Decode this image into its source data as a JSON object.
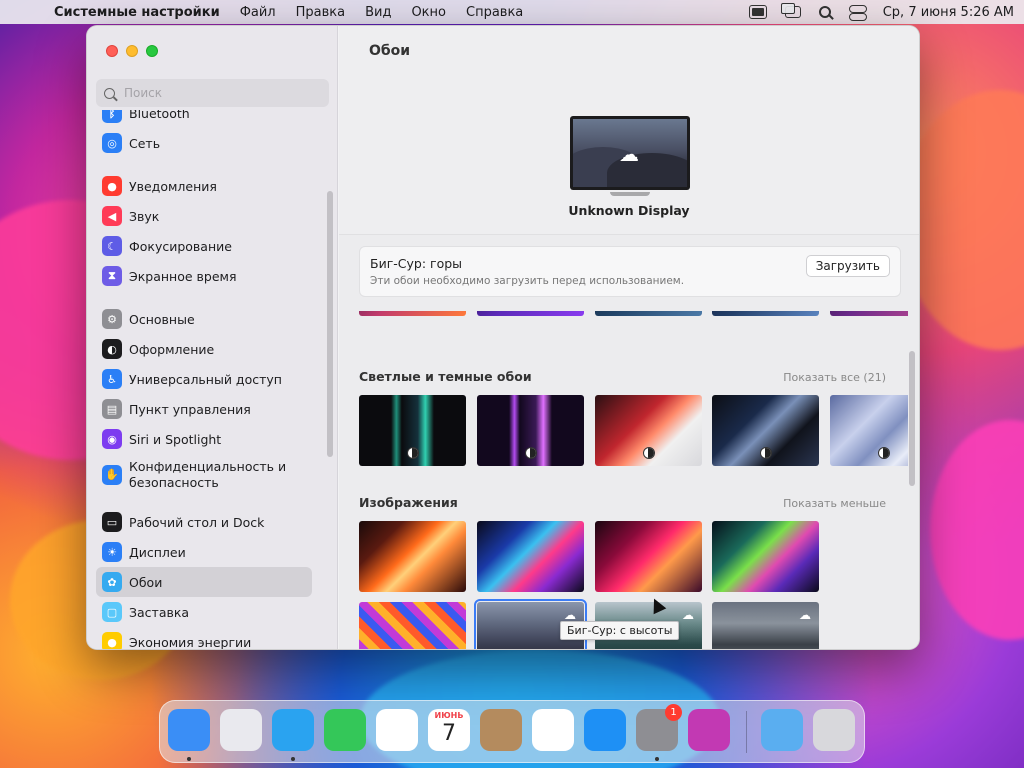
{
  "menubar": {
    "app_name": "Системные настройки",
    "items": [
      "Файл",
      "Правка",
      "Вид",
      "Окно",
      "Справка"
    ],
    "datetime": "Ср, 7 июня  5:26 AM"
  },
  "sidebar": {
    "search_placeholder": "Поиск",
    "items": [
      {
        "label": "Bluetooth",
        "icon": "bluetooth-icon",
        "color": "#2b7ff6"
      },
      {
        "label": "Сеть",
        "icon": "globe-icon",
        "color": "#2b7ff6"
      },
      {
        "label": "Уведомления",
        "icon": "bell-icon",
        "color": "#ff3b30"
      },
      {
        "label": "Звук",
        "icon": "speaker-icon",
        "color": "#ff3b57"
      },
      {
        "label": "Фокусирование",
        "icon": "moon-icon",
        "color": "#5e5ce6"
      },
      {
        "label": "Экранное время",
        "icon": "hourglass-icon",
        "color": "#6e5ce6"
      },
      {
        "label": "Основные",
        "icon": "gear-icon",
        "color": "#8e8e93"
      },
      {
        "label": "Оформление",
        "icon": "appearance-icon",
        "color": "#1c1c1e"
      },
      {
        "label": "Универсальный доступ",
        "icon": "accessibility-icon",
        "color": "#2b7ff6"
      },
      {
        "label": "Пункт управления",
        "icon": "control-center-icon",
        "color": "#8e8e93"
      },
      {
        "label": "Siri и Spotlight",
        "icon": "siri-icon",
        "color": "#7d3cf0"
      },
      {
        "label": "Конфиденциальность и безопасность",
        "icon": "hand-icon",
        "color": "#2b7ff6"
      },
      {
        "label": "Рабочий стол и Dock",
        "icon": "dock-icon",
        "color": "#1c1c1e"
      },
      {
        "label": "Дисплеи",
        "icon": "sun-icon",
        "color": "#2b7ff6"
      },
      {
        "label": "Обои",
        "icon": "wallpaper-icon",
        "color": "#35aaf0"
      },
      {
        "label": "Заставка",
        "icon": "screensaver-icon",
        "color": "#5ac8fa"
      },
      {
        "label": "Экономия энергии",
        "icon": "bulb-icon",
        "color": "#ffcc00"
      }
    ],
    "active_item": "Обои"
  },
  "main": {
    "title": "Обои",
    "display_name": "Unknown Display",
    "card": {
      "title": "Биг-Сур: горы",
      "subtitle": "Эти обои необходимо загрузить перед использованием.",
      "button": "Загрузить"
    },
    "section_light_dark": {
      "title": "Светлые и темные обои",
      "link": "Показать все (21)"
    },
    "section_images": {
      "title": "Изображения",
      "link": "Показать меньше"
    },
    "tooltip": "Биг-Сур: с высоты"
  },
  "dock": {
    "apps": [
      {
        "name": "finder-icon",
        "color": "#3a8ef6"
      },
      {
        "name": "launchpad-icon",
        "color": "#e9e9ee"
      },
      {
        "name": "safari-icon",
        "color": "#2aa3f0"
      },
      {
        "name": "messages-icon",
        "color": "#34c759"
      },
      {
        "name": "photos-icon",
        "color": "#ffffff"
      },
      {
        "name": "calendar-icon",
        "color": "#ffffff"
      },
      {
        "name": "contacts-icon",
        "color": "#b48b5e"
      },
      {
        "name": "reminders-icon",
        "color": "#ffffff"
      },
      {
        "name": "app-store-icon",
        "color": "#1e90f5"
      },
      {
        "name": "system-settings-icon",
        "color": "#8e8e93"
      },
      {
        "name": "screen-time-icon",
        "color": "#c239b3"
      },
      {
        "name": "downloads-folder-icon",
        "color": "#5aaef0"
      },
      {
        "name": "trash-icon",
        "color": "#d8d8dc"
      }
    ],
    "calendar": {
      "month": "ИЮНЬ",
      "day": "7"
    },
    "settings_badge": "1"
  }
}
